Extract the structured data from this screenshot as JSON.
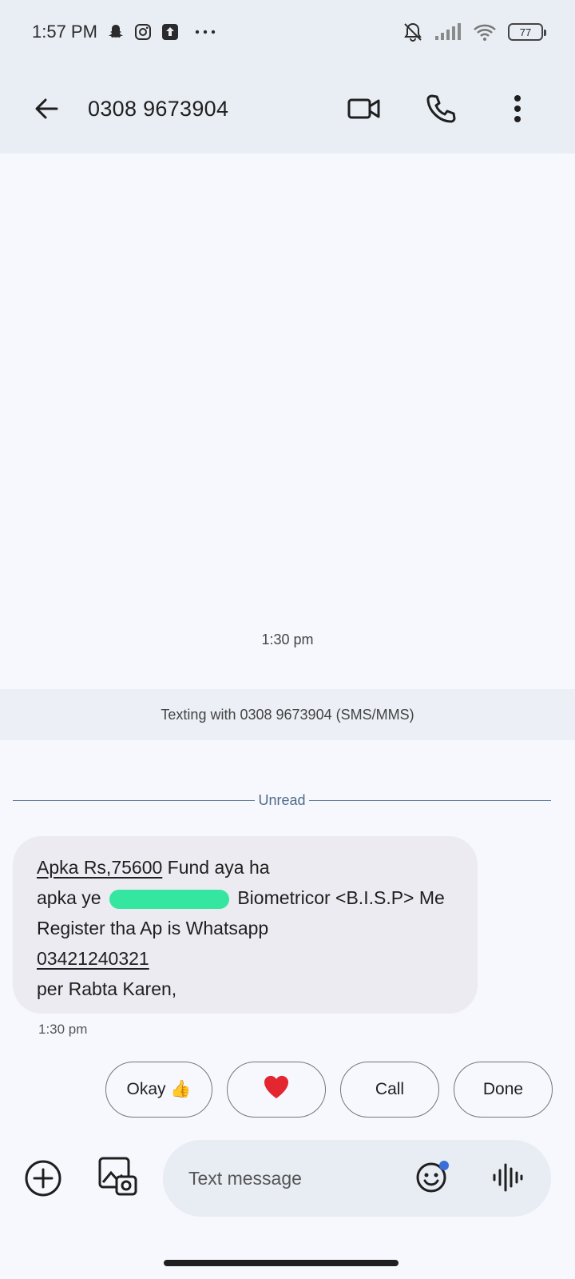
{
  "status_bar": {
    "time": "1:57 PM",
    "battery": "77",
    "icons": [
      "snapchat-icon",
      "instagram-icon",
      "upload-icon",
      "more-icon",
      "bell-off-icon",
      "signal-icon",
      "wifi-icon",
      "battery-icon"
    ]
  },
  "app_bar": {
    "title": "0308 9673904",
    "back_icon": "arrow-back-icon",
    "actions": [
      "video-call-icon",
      "phone-icon",
      "more-vert-icon"
    ]
  },
  "conversation": {
    "top_timestamp": "1:30 pm",
    "texting_banner": "Texting with 0308 9673904 (SMS/MMS)",
    "unread_label": "Unread",
    "message": {
      "line1_link": "Apka Rs,75600",
      "line1_text": " Fund aya ha",
      "line2_prefix": "apka ye ",
      "line2_suffix": " Biometricor <B.I.S.P> Me",
      "line3": "Register tha Ap is Whatsapp",
      "line4_link": "03421240321",
      "line5": "per Rabta Karen,",
      "time": "1:30 pm"
    }
  },
  "smart_replies": {
    "okay": "Okay",
    "okay_emoji": "👍",
    "heart": "❤️",
    "call": "Call",
    "done": "Done"
  },
  "composer": {
    "placeholder": "Text message"
  }
}
